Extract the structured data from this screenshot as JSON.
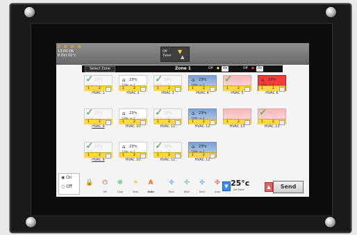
{
  "header": {
    "brand": "C K O N",
    "time": "13:00",
    "ok": "OK",
    "date": "8 Oct 02°c",
    "timer_label_top": "Off",
    "timer_label_bottom": "Timer"
  },
  "subbar": {
    "select_zone": "Select Zone",
    "zone_title": "Zone 1",
    "lights_off": "Off",
    "lights_on": "On",
    "power_off": "Off",
    "power_on": "On"
  },
  "tiles": [
    {
      "label": "HVAC 1",
      "temp": "23ºc",
      "temp2": "33ºc ≥ 1",
      "bar1": "1",
      "bar2": "2"
    },
    {
      "label": "HVAC 2",
      "temp": "23ºc",
      "temp2": "33ºc ≥ 1",
      "bar1": "1",
      "bar2": "2"
    },
    {
      "label": "HVAC 3",
      "temp": "23ºc",
      "temp2": "33ºc ≥ 1",
      "bar1": "1",
      "bar2": "2"
    },
    {
      "label": "HVAC 4",
      "temp": "23ºc",
      "temp2": "18ºc ≥ 1",
      "bar1": "1",
      "bar2": "2"
    },
    {
      "label": "HVAC 5",
      "temp": "23ºc",
      "temp2": "33ºc ≥ 1",
      "bar1": "1",
      "bar2": "2"
    },
    {
      "label": "HVAC 6",
      "temp": "23ºc",
      "temp2": "33ºc ≥ 1",
      "bar1": "1",
      "bar2": "2"
    },
    {
      "label": "HVAC 9",
      "temp": "23ºc",
      "temp2": "33ºc ≥ 1",
      "bar1": "1",
      "bar2": "2"
    },
    {
      "label": "HVAC 10",
      "temp": "23ºc",
      "temp2": "33ºc ≥ 1",
      "bar1": "1",
      "bar2": "2"
    },
    {
      "label": "HVAC 11",
      "temp": "23ºc",
      "temp2": "33ºc ≥ 1",
      "bar1": "1",
      "bar2": "2"
    },
    {
      "label": "HVAC 12",
      "temp": "23ºc",
      "temp2": "18ºc ≥ 1",
      "bar1": "1",
      "bar2": "2"
    },
    {
      "label": "HVAC 13",
      "temp": "23ºc",
      "temp2": "33ºc ≥ 1",
      "bar1": "1",
      "bar2": "2"
    },
    {
      "label": "HVAC 13",
      "temp": "23ºc",
      "temp2": "33ºc ≥ 1",
      "bar1": "1",
      "bar2": "2"
    },
    {
      "label": "HVAC 9",
      "temp": "23ºc",
      "temp2": "33ºc ≥ 1",
      "bar1": "1",
      "bar2": "2"
    },
    {
      "label": "HVAC 10",
      "temp": "23ºc",
      "temp2": "33ºc ≥ 1",
      "bar1": "1",
      "bar2": "2"
    },
    {
      "label": "HVAC 11",
      "temp": "23ºc",
      "temp2": "33ºc ≥ 1",
      "bar1": "1",
      "bar2": "2"
    },
    {
      "label": "HVAC 12",
      "temp": "23ºc",
      "temp2": "18ºc ≥ 1",
      "bar1": "1",
      "bar2": "2"
    }
  ],
  "left_panel": {
    "on": "On",
    "off": "Off"
  },
  "bottom": {
    "off_cap": "Off",
    "cool_cap": "Cool",
    "heat_cap": "Heat",
    "auto_cap": "Auto",
    "fan1_cap": "Fan1",
    "fan2_cap": "Fan2",
    "fan3_cap": "Fan3",
    "fan_auto_cap": "Auto",
    "setpoint": "25°c",
    "setpoint_cap": "Set Point",
    "send": "Send"
  }
}
